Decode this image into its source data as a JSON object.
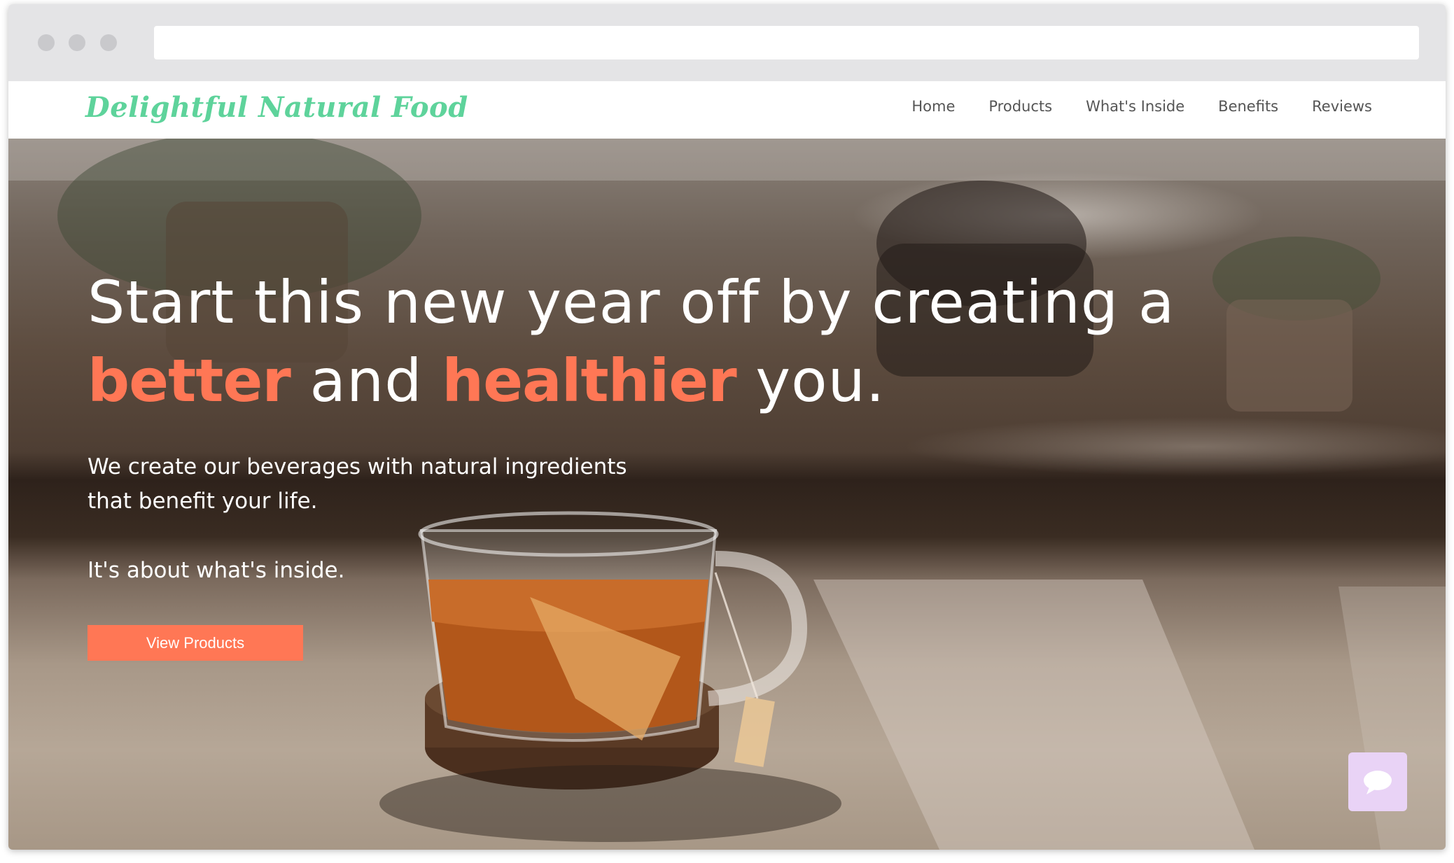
{
  "site": {
    "logo_text": "Delightful Natural Food"
  },
  "nav": {
    "items": [
      {
        "label": "Home"
      },
      {
        "label": "Products"
      },
      {
        "label": "What's Inside"
      },
      {
        "label": "Benefits"
      },
      {
        "label": "Reviews"
      }
    ]
  },
  "hero": {
    "headline_line1": "Start this new year off by creating a",
    "headline_accent1": "better",
    "headline_mid": "and",
    "headline_accent2": "healthier",
    "headline_end": "you.",
    "paragraph_line1": "We create our beverages with natural ingredients",
    "paragraph_line2": "that benefit your life.",
    "tagline": "It's about what's inside.",
    "cta_label": "View Products"
  },
  "colors": {
    "brand_green": "#5ed39b",
    "accent_coral": "#ff7755",
    "chat_lavender": "#e9d3f6",
    "nav_text": "#555555"
  },
  "icons": {
    "chat": "chat-bubble-icon"
  }
}
